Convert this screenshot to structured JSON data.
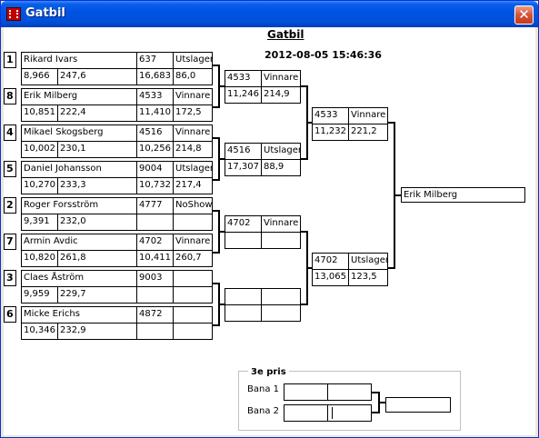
{
  "window": {
    "title": "Gatbil",
    "close_label": "✕"
  },
  "header": {
    "title": "Gatbil",
    "datetime": "2012-08-05 15:46:36"
  },
  "round1": [
    {
      "seed": "1",
      "name": "Rikard Ivars",
      "rt": "8,966",
      "speed": "247,6",
      "car": "637",
      "result": "Utslager",
      "time": "16,683",
      "trap": "86,0"
    },
    {
      "seed": "8",
      "name": "Erik Milberg",
      "rt": "10,851",
      "speed": "222,4",
      "car": "4533",
      "result": "Vinnare",
      "time": "11,410",
      "trap": "172,5"
    },
    {
      "seed": "4",
      "name": "Mikael Skogsberg",
      "rt": "10,002",
      "speed": "230,1",
      "car": "4516",
      "result": "Vinnare",
      "time": "10,256",
      "trap": "214,8"
    },
    {
      "seed": "5",
      "name": "Daniel Johansson",
      "rt": "10,270",
      "speed": "233,3",
      "car": "9004",
      "result": "Utslager",
      "time": "10,732",
      "trap": "217,4"
    },
    {
      "seed": "2",
      "name": "Roger Forsström",
      "rt": "9,391",
      "speed": "232,0",
      "car": "4777",
      "result": "NoShow",
      "time": "",
      "trap": ""
    },
    {
      "seed": "7",
      "name": "Armin Avdic",
      "rt": "10,820",
      "speed": "261,8",
      "car": "4702",
      "result": "Vinnare",
      "time": "10,411",
      "trap": "260,7"
    },
    {
      "seed": "3",
      "name": "Claes Åström",
      "rt": "9,959",
      "speed": "229,7",
      "car": "9003",
      "result": "",
      "time": "",
      "trap": ""
    },
    {
      "seed": "6",
      "name": "Micke Erichs",
      "rt": "10,346",
      "speed": "232,9",
      "car": "4872",
      "result": "",
      "time": "",
      "trap": ""
    }
  ],
  "quarter": [
    {
      "car": "4533",
      "result": "Vinnare",
      "time": "11,246",
      "trap": "214,9"
    },
    {
      "car": "4516",
      "result": "Utslager",
      "time": "17,307",
      "trap": "88,9"
    },
    {
      "car": "4702",
      "result": "Vinnare",
      "time": "",
      "trap": ""
    },
    {
      "car": "",
      "result": "",
      "time": "",
      "trap": ""
    }
  ],
  "semi": [
    {
      "car": "4533",
      "result": "Vinnare",
      "time": "11,232",
      "trap": "221,2"
    },
    {
      "car": "4702",
      "result": "Utslager",
      "time": "13,065",
      "trap": "123,5"
    }
  ],
  "final": {
    "winner": "Erik Milberg"
  },
  "third_place": {
    "label": "3e pris",
    "lanes": [
      {
        "label": "Bana 1"
      },
      {
        "label": "Bana 2"
      }
    ],
    "winner": ""
  }
}
